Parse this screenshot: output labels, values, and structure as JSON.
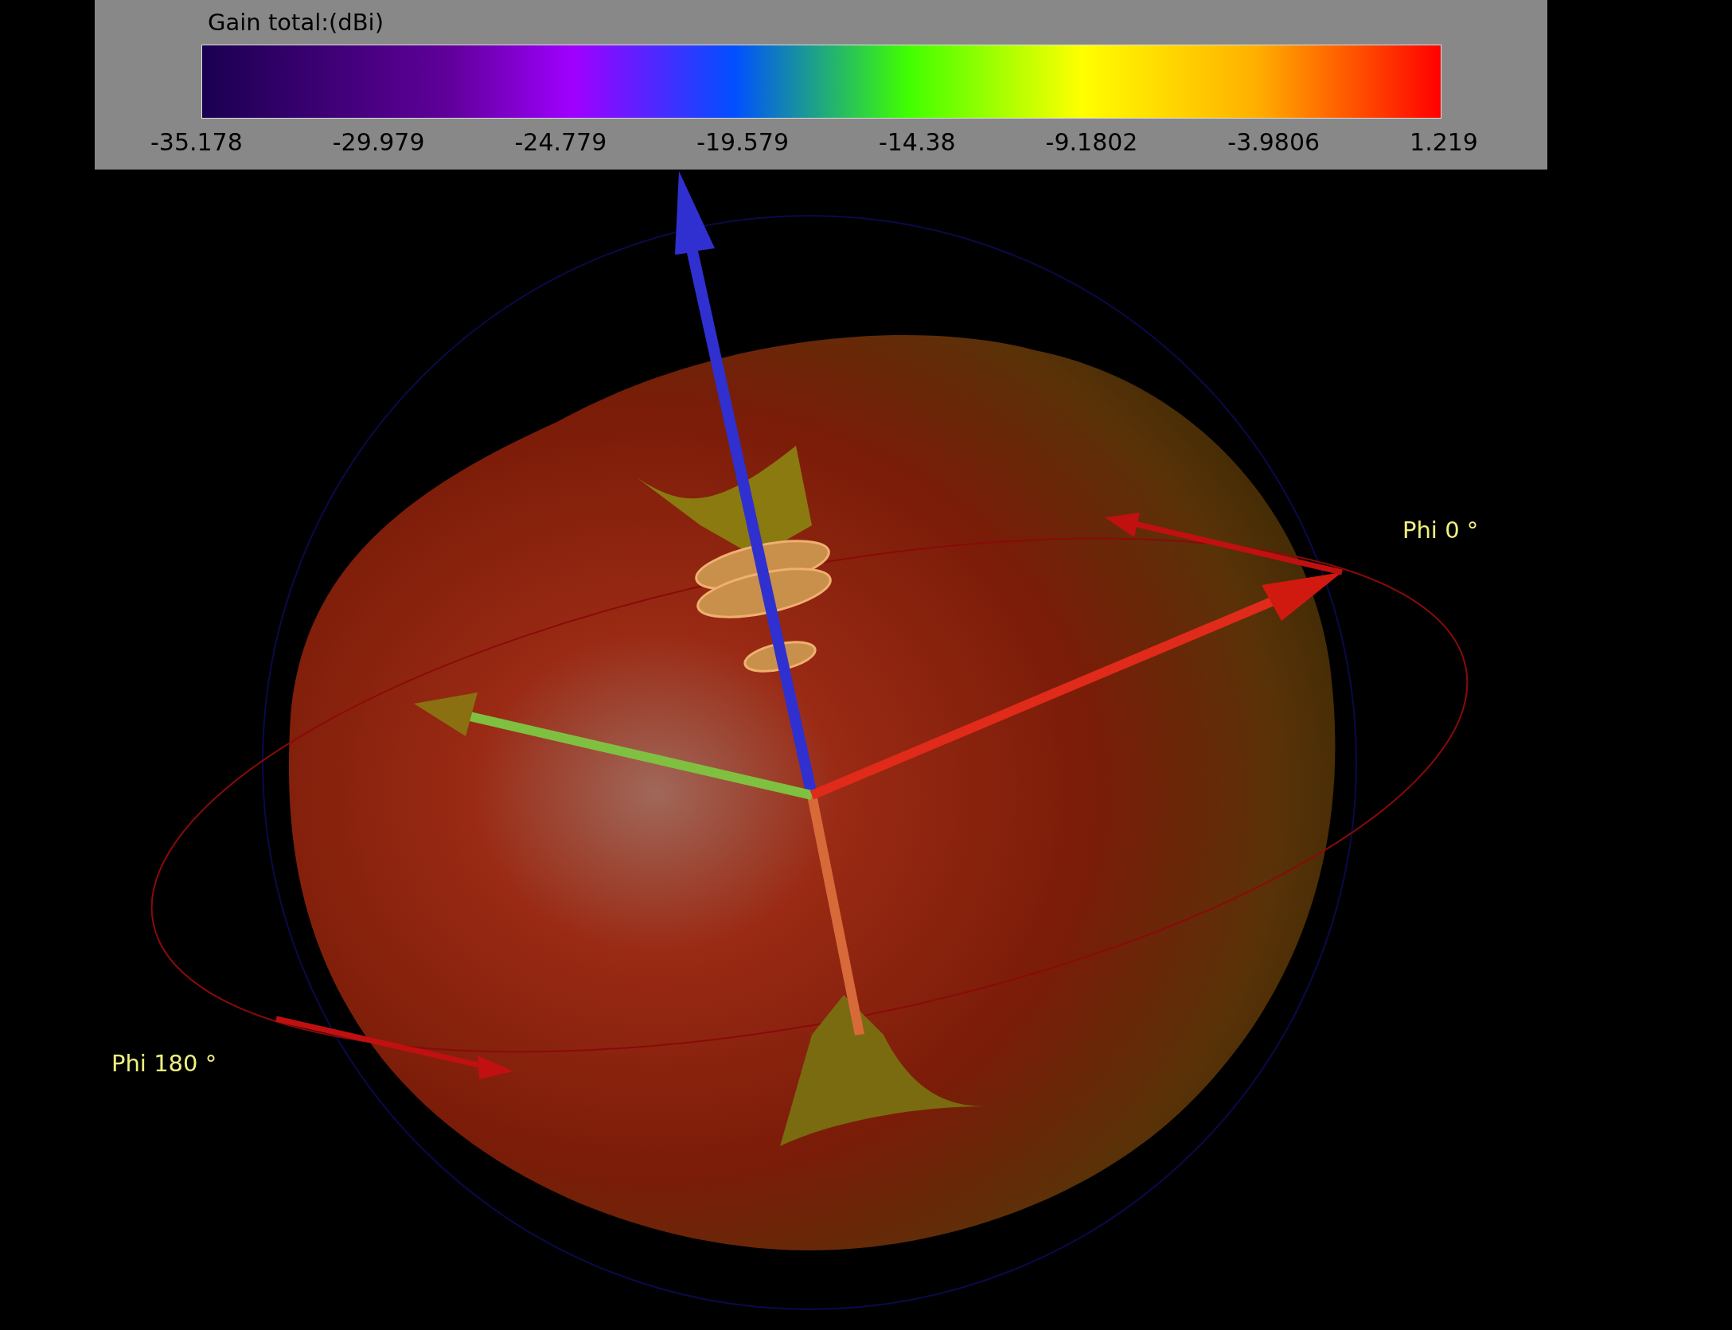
{
  "legend": {
    "title": "Gain total:(dBi)",
    "ticks": [
      "-35.178",
      "-29.979",
      "-24.779",
      "-19.579",
      "-14.38",
      "-9.1802",
      "-3.9806",
      "1.219"
    ]
  },
  "scene_labels": [
    {
      "text": "Phi 0 °"
    },
    {
      "text": "Phi 180 °"
    }
  ]
}
